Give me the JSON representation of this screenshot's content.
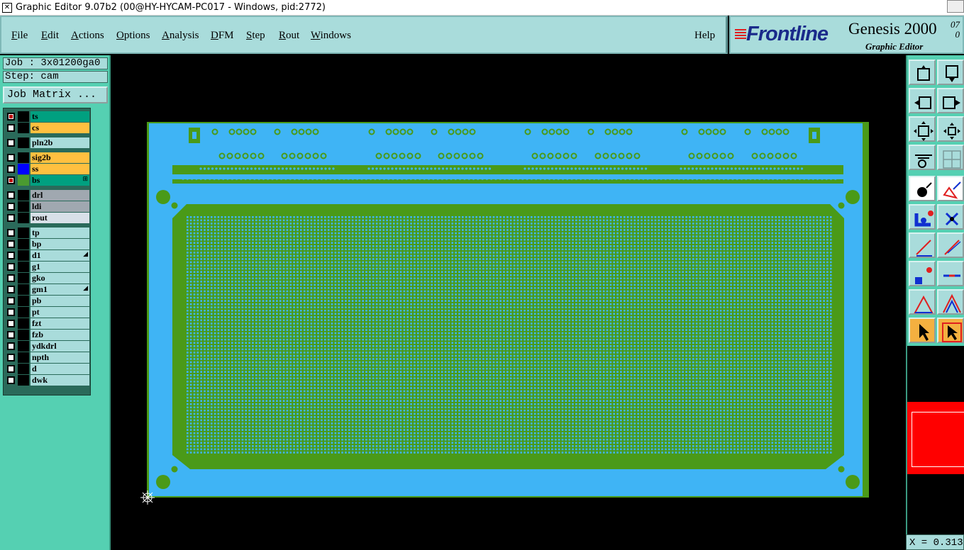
{
  "window": {
    "title": "Graphic Editor 9.07b2 (00@HY-HYCAM-PC017 - Windows, pid:2772)"
  },
  "menu": {
    "items": [
      {
        "label": "File",
        "underline": "F",
        "rest": "ile"
      },
      {
        "label": "Edit",
        "underline": "E",
        "rest": "dit"
      },
      {
        "label": "Actions",
        "underline": "A",
        "rest": "ctions"
      },
      {
        "label": "Options",
        "underline": "O",
        "rest": "ptions"
      },
      {
        "label": "Analysis",
        "underline": "A",
        "rest": "nalysis"
      },
      {
        "label": "DFM",
        "underline": "D",
        "rest": "FM"
      },
      {
        "label": "Step",
        "underline": "S",
        "rest": "tep"
      },
      {
        "label": "Rout",
        "underline": "R",
        "rest": "out"
      },
      {
        "label": "Windows",
        "underline": "W",
        "rest": "indows"
      }
    ],
    "help": "Help"
  },
  "brand": {
    "logo": "Frontline",
    "product": "Genesis 2000",
    "version_top": "07",
    "version_bottom": "0",
    "subtitle": "Graphic Editor"
  },
  "job": {
    "job_label": "Job : 3x01200ga0",
    "step_label": "Step: cam",
    "matrix_button": "Job Matrix ..."
  },
  "layers": [
    {
      "name": "ts",
      "color": "#00a080",
      "active": true,
      "swatch": "#000000"
    },
    {
      "name": "cs",
      "color": "#ffc040",
      "active": false,
      "swatch": "#000000"
    },
    {
      "name": "pln2b",
      "color": "#a9dcdb",
      "active": false,
      "swatch": "#000000",
      "gap": true
    },
    {
      "name": "sig2b",
      "color": "#ffc040",
      "active": false,
      "swatch": "#000000",
      "gap": true
    },
    {
      "name": "ss",
      "color": "#ffc040",
      "active": false,
      "swatch": "#0000ff"
    },
    {
      "name": "bs",
      "color": "#00a080",
      "active": true,
      "swatch": "#4a9a30",
      "mark": "⊞"
    },
    {
      "name": "drl",
      "color": "#a0a8b0",
      "active": false,
      "swatch": "#000000",
      "gap": true
    },
    {
      "name": "ldi",
      "color": "#a0a8b0",
      "active": false,
      "swatch": "#000000"
    },
    {
      "name": "rout",
      "color": "#d8e0e8",
      "active": false,
      "swatch": "#000000"
    },
    {
      "name": "tp",
      "color": "#a9dcdb",
      "active": false,
      "swatch": "#000000",
      "gap": true
    },
    {
      "name": "bp",
      "color": "#a9dcdb",
      "active": false,
      "swatch": "#000000"
    },
    {
      "name": "d1",
      "color": "#a9dcdb",
      "active": false,
      "swatch": "#000000",
      "mark": "◢"
    },
    {
      "name": "g1",
      "color": "#a9dcdb",
      "active": false,
      "swatch": "#000000"
    },
    {
      "name": "gko",
      "color": "#a9dcdb",
      "active": false,
      "swatch": "#000000"
    },
    {
      "name": "gm1",
      "color": "#a9dcdb",
      "active": false,
      "swatch": "#000000",
      "mark": "◢"
    },
    {
      "name": "pb",
      "color": "#a9dcdb",
      "active": false,
      "swatch": "#000000"
    },
    {
      "name": "pt",
      "color": "#a9dcdb",
      "active": false,
      "swatch": "#000000"
    },
    {
      "name": "fzt",
      "color": "#a9dcdb",
      "active": false,
      "swatch": "#000000"
    },
    {
      "name": "fzb",
      "color": "#a9dcdb",
      "active": false,
      "swatch": "#000000"
    },
    {
      "name": "ydkdrl",
      "color": "#a9dcdb",
      "active": false,
      "swatch": "#000000"
    },
    {
      "name": "npth",
      "color": "#a9dcdb",
      "active": false,
      "swatch": "#000000"
    },
    {
      "name": "d",
      "color": "#a9dcdb",
      "active": false,
      "swatch": "#000000"
    },
    {
      "name": "dwk",
      "color": "#a9dcdb",
      "active": false,
      "swatch": "#000000"
    }
  ],
  "toolbar": {
    "tools": [
      {
        "name": "pan-up-icon"
      },
      {
        "name": "pan-down-icon"
      },
      {
        "name": "pan-left-icon"
      },
      {
        "name": "pan-right-icon"
      },
      {
        "name": "zoom-fit-icon"
      },
      {
        "name": "zoom-home-icon"
      },
      {
        "name": "measure-icon"
      },
      {
        "name": "grid-icon"
      },
      {
        "name": "add-feature-icon"
      },
      {
        "name": "edit-shape-icon"
      },
      {
        "name": "net-select-icon"
      },
      {
        "name": "cross-select-icon"
      },
      {
        "name": "line-angle-icon"
      },
      {
        "name": "line-draw-icon"
      },
      {
        "name": "pad-icon"
      },
      {
        "name": "line-h-icon"
      },
      {
        "name": "triangle-icon"
      },
      {
        "name": "triangle-outline-icon"
      },
      {
        "name": "pointer-icon"
      },
      {
        "name": "pointer-select-icon"
      }
    ]
  },
  "status": {
    "coordinate": "X = 0.313"
  },
  "colors": {
    "board_blue": "#3fb4f5",
    "board_green": "#4a9a18",
    "panel_teal": "#55d0b2",
    "menu_bg": "#a9dcdb"
  }
}
